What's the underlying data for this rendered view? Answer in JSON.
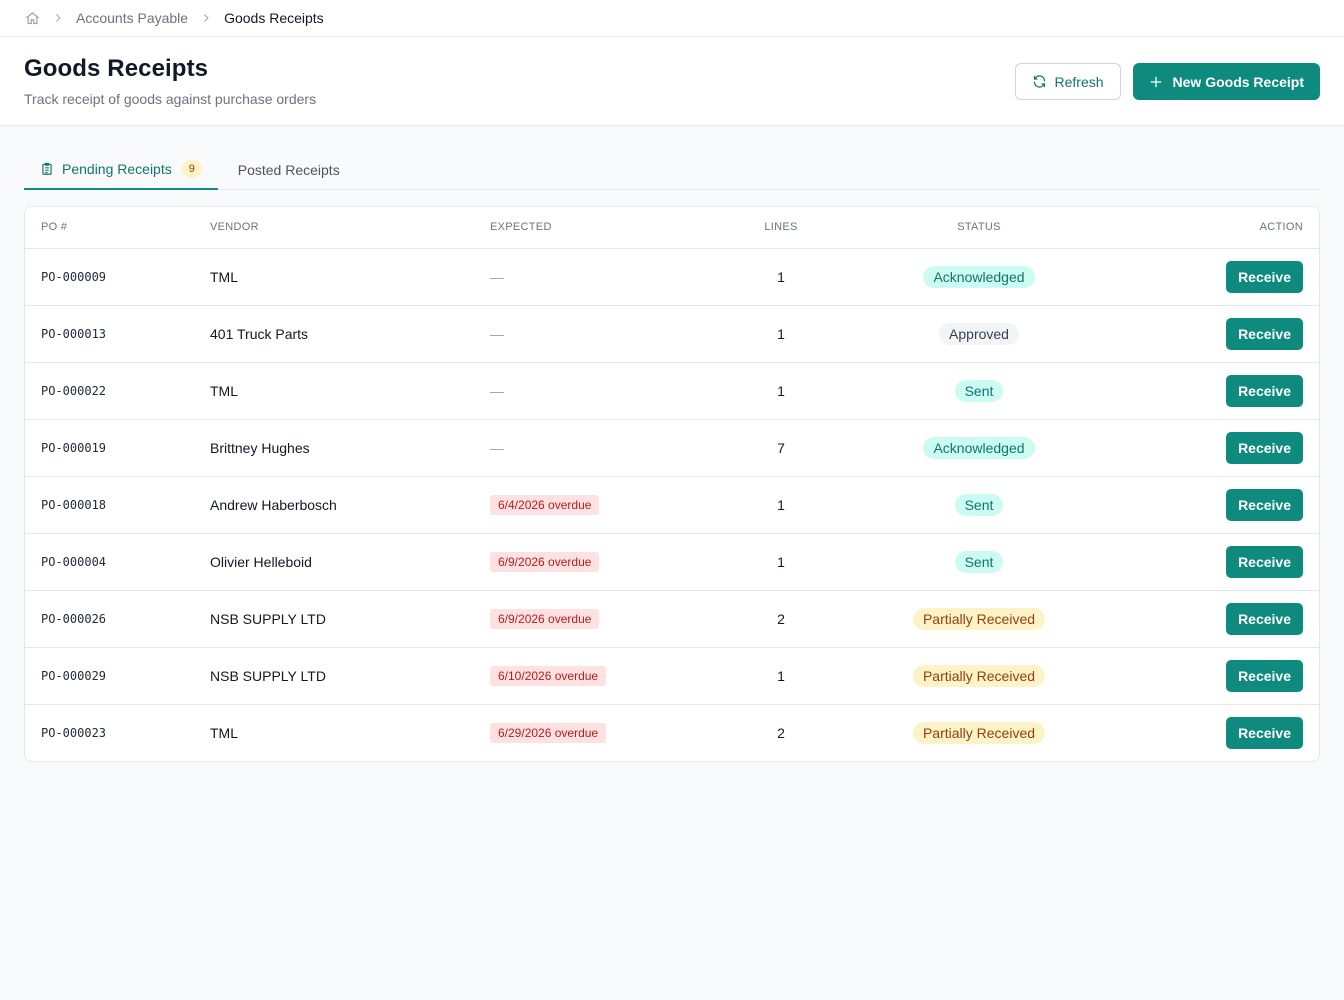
{
  "breadcrumb": {
    "home_icon": "home-icon",
    "items": [
      "Accounts Payable",
      "Goods Receipts"
    ]
  },
  "header": {
    "title": "Goods Receipts",
    "subtitle": "Track receipt of goods against purchase orders",
    "refresh_label": "Refresh",
    "new_label": "New Goods Receipt"
  },
  "tabs": [
    {
      "label": "Pending Receipts",
      "count": "9",
      "active": true,
      "icon": "clipboard-icon"
    },
    {
      "label": "Posted Receipts",
      "active": false
    }
  ],
  "table": {
    "columns": [
      "PO #",
      "VENDOR",
      "EXPECTED",
      "LINES",
      "STATUS",
      "ACTION"
    ],
    "rows": [
      {
        "po": "PO-000009",
        "vendor": "TML",
        "expected": "—",
        "lines": "1",
        "status": "Acknowledged",
        "status_kind": "ack",
        "action": "Receive"
      },
      {
        "po": "PO-000013",
        "vendor": "401 Truck Parts",
        "expected": "—",
        "lines": "1",
        "status": "Approved",
        "status_kind": "approved",
        "action": "Receive"
      },
      {
        "po": "PO-000022",
        "vendor": "TML",
        "expected": "—",
        "lines": "1",
        "status": "Sent",
        "status_kind": "sent",
        "action": "Receive"
      },
      {
        "po": "PO-000019",
        "vendor": "Brittney Hughes",
        "expected": "—",
        "lines": "7",
        "status": "Acknowledged",
        "status_kind": "ack",
        "action": "Receive"
      },
      {
        "po": "PO-000018",
        "vendor": "Andrew Haberbosch",
        "expected": "6/4/2026 overdue",
        "lines": "1",
        "status": "Sent",
        "status_kind": "sent",
        "action": "Receive"
      },
      {
        "po": "PO-000004",
        "vendor": "Olivier Helleboid",
        "expected": "6/9/2026 overdue",
        "lines": "1",
        "status": "Sent",
        "status_kind": "sent",
        "action": "Receive"
      },
      {
        "po": "PO-000026",
        "vendor": "NSB SUPPLY LTD",
        "expected": "6/9/2026 overdue",
        "lines": "2",
        "status": "Partially Received",
        "status_kind": "partial",
        "action": "Receive"
      },
      {
        "po": "PO-000029",
        "vendor": "NSB SUPPLY LTD",
        "expected": "6/10/2026 overdue",
        "lines": "1",
        "status": "Partially Received",
        "status_kind": "partial",
        "action": "Receive"
      },
      {
        "po": "PO-000023",
        "vendor": "TML",
        "expected": "6/29/2026 overdue",
        "lines": "2",
        "status": "Partially Received",
        "status_kind": "partial",
        "action": "Receive"
      }
    ]
  },
  "colors": {
    "accent": "#0f8a7e",
    "overdue_bg": "#fee2e2",
    "overdue_text": "#b91c1c",
    "ack_bg": "#ccfbf1",
    "partial_bg": "#fef3c7"
  }
}
